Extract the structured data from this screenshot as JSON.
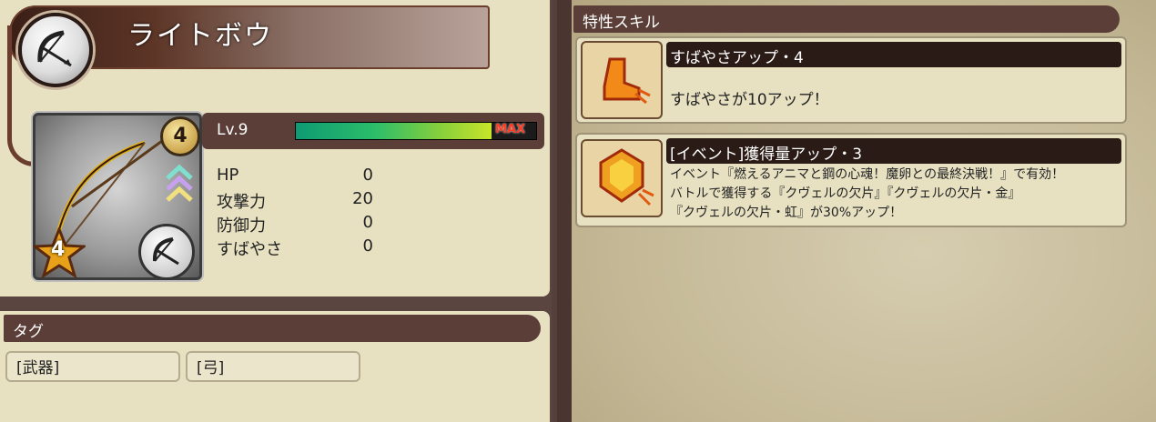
{
  "weapon": {
    "name": "ライトボウ",
    "rank": "4",
    "star_level": "4",
    "level_label": "Lv.9",
    "exp_max_label": "MAX",
    "exp_fraction": 0.82
  },
  "stats": [
    {
      "label": "HP",
      "value": "0"
    },
    {
      "label": "攻撃力",
      "value": "20"
    },
    {
      "label": "防御力",
      "value": "0"
    },
    {
      "label": "すばやさ",
      "value": "0"
    }
  ],
  "tags": {
    "title": "タグ",
    "items": [
      "[武器]",
      "[弓]"
    ]
  },
  "skills": {
    "title": "特性スキル",
    "items": [
      {
        "name": "すばやさアップ・4",
        "desc_lines": [
          "すばやさが10アップ！"
        ],
        "icon": "boot-icon"
      },
      {
        "name": "[イベント]獲得量アップ・3",
        "desc_lines": [
          "イベント『燃えるアニマと鋼の心魂！魔卵との最終決戦！』で有効！",
          "バトルで獲得する『クヴェルの欠片』『クヴェルの欠片・金』",
          "『クヴェルの欠片・虹』が30%アップ！"
        ],
        "icon": "gem-icon"
      }
    ]
  },
  "colors": {
    "accent": "#5a3e37",
    "panel": "#e7e1c2",
    "max_text": "#ff3a20"
  }
}
